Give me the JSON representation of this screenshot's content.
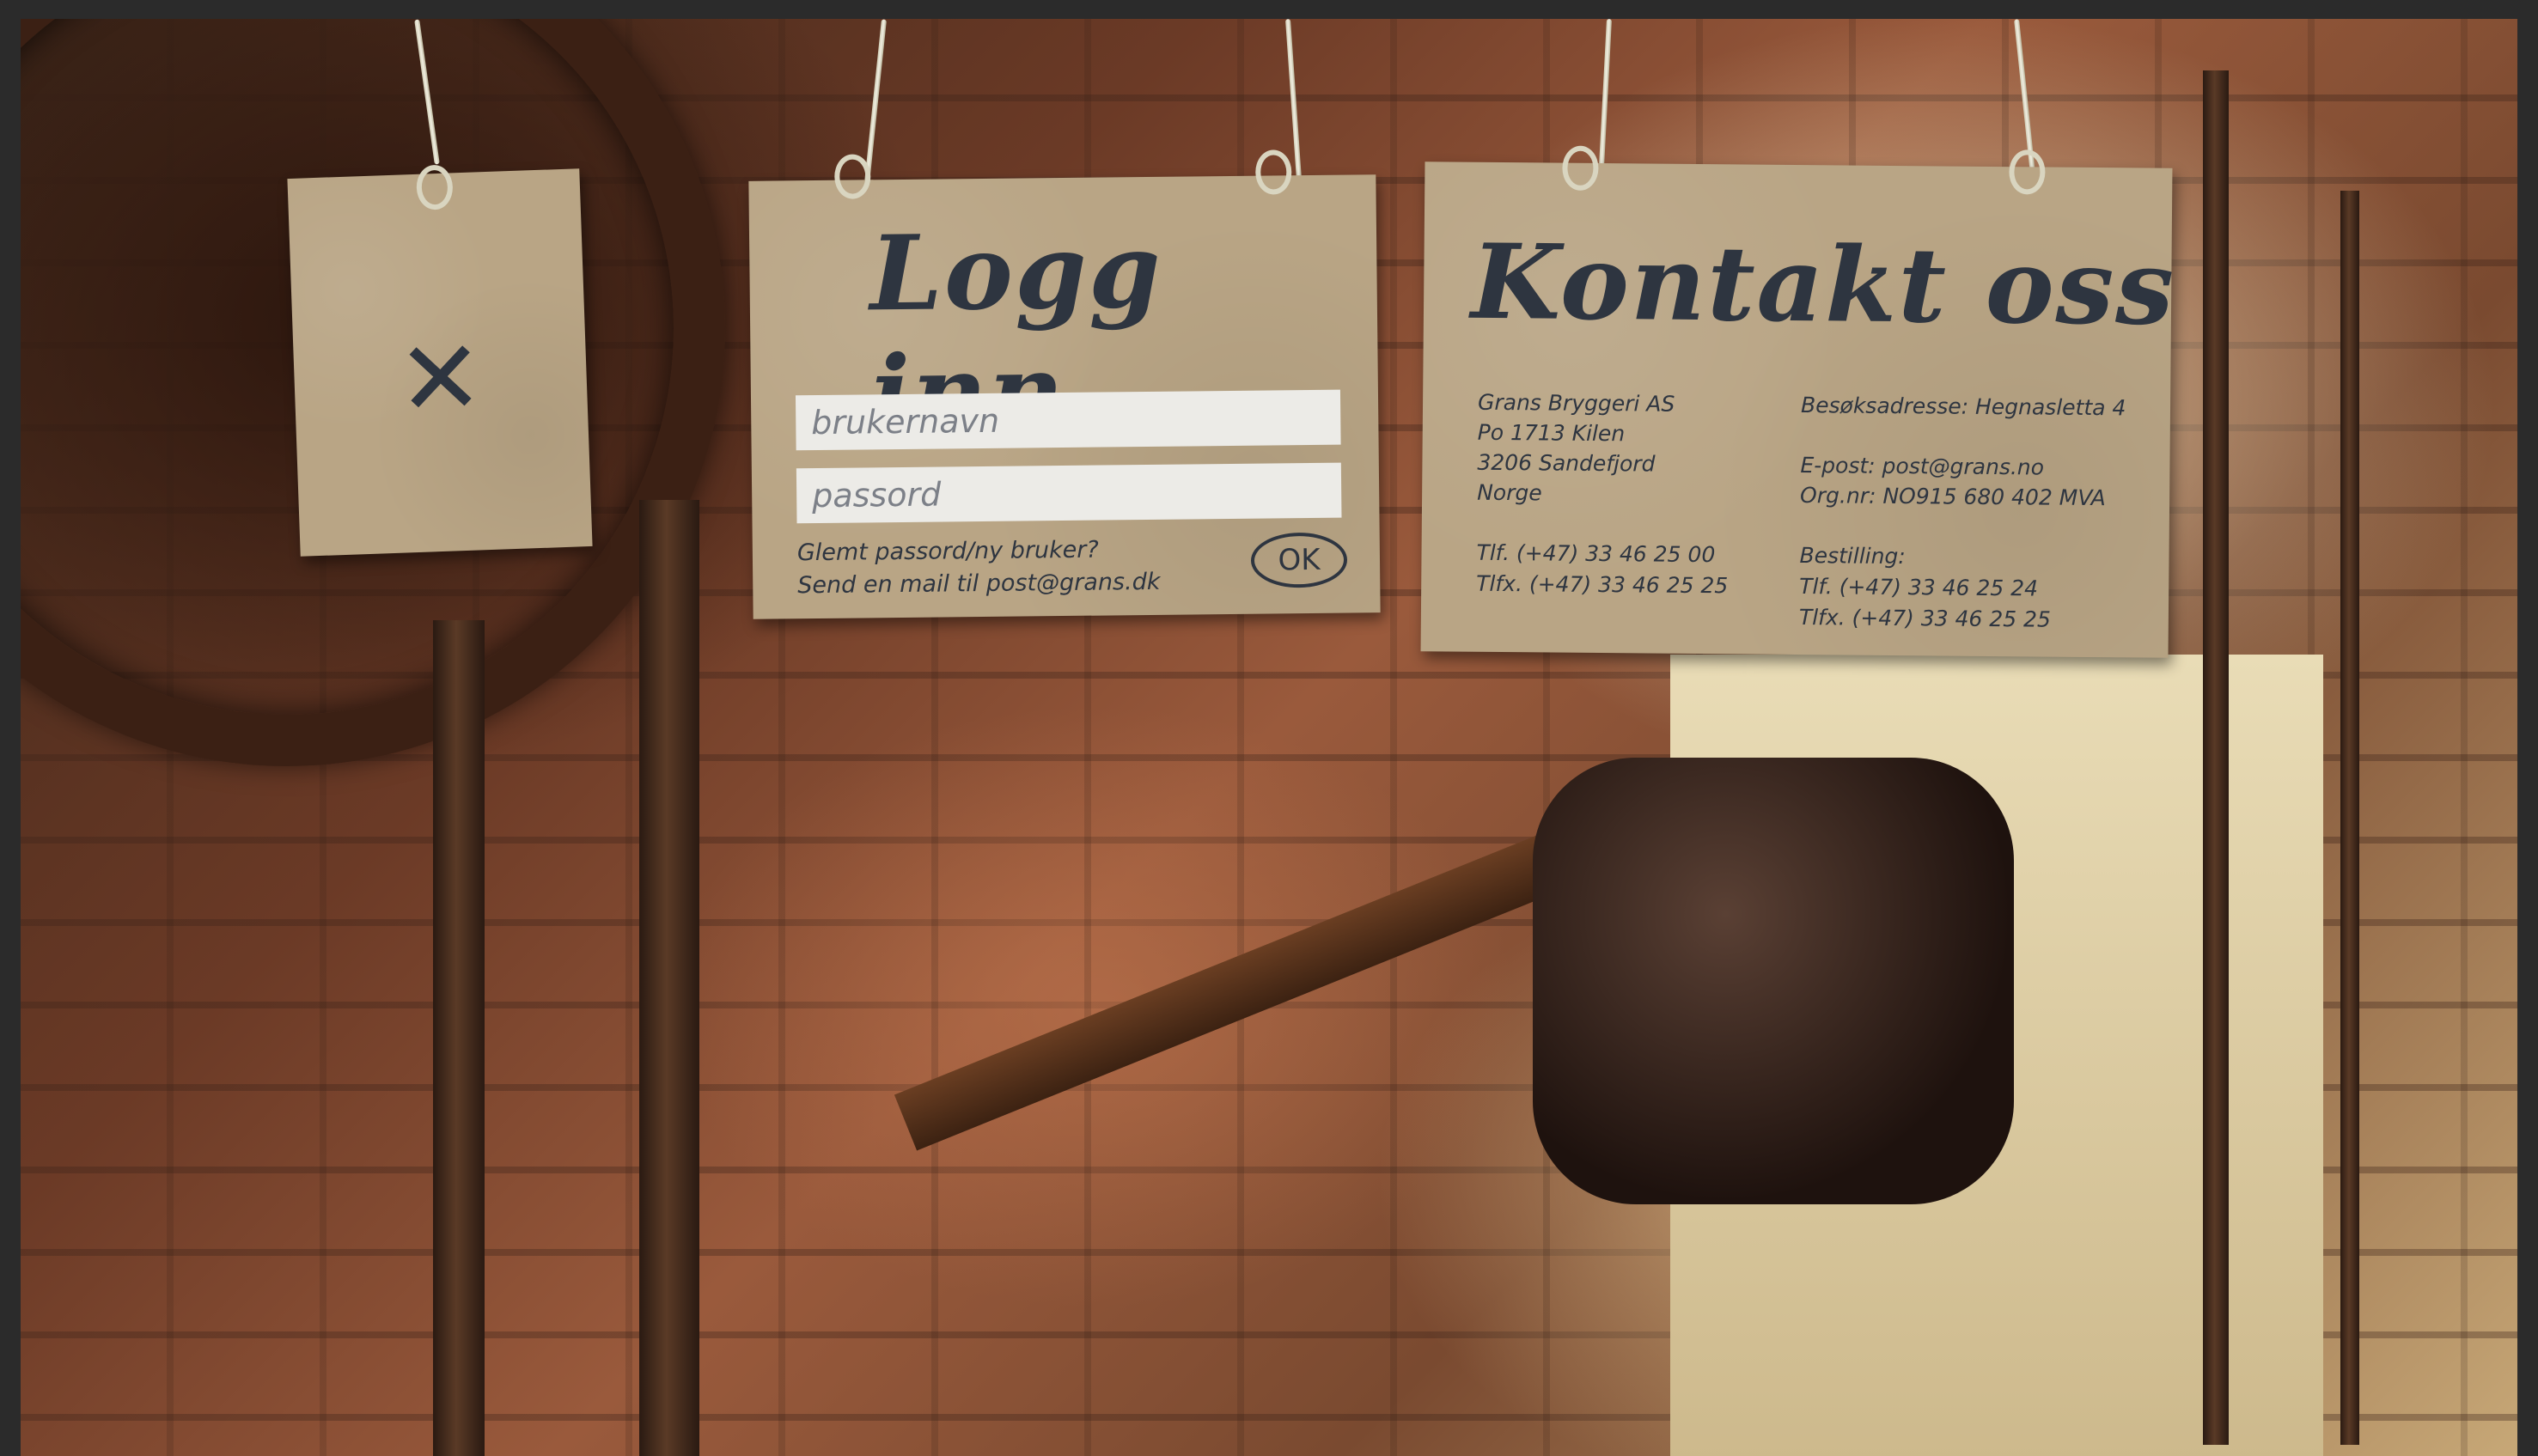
{
  "close_card": {
    "glyph": "✕",
    "icon": "close-icon"
  },
  "login": {
    "title": "Logg inn",
    "username_placeholder": "brukernavn",
    "password_placeholder": "passord",
    "forgot_text": "Glemt passord/ny bruker?",
    "mail_text": "Send en mail til post@grans.dk",
    "ok_label": "OK"
  },
  "contact": {
    "title": "Kontakt oss",
    "left": {
      "company": "Grans Bryggeri AS",
      "po": "Po 1713 Kilen",
      "city": "3206 Sandefjord",
      "country": "Norge",
      "phone": "Tlf. (+47) 33 46 25 00",
      "fax": "Tlfx. (+47) 33 46 25 25"
    },
    "right": {
      "visit": "Besøksadresse: Hegnasletta 4",
      "email": "E-post: post@grans.no",
      "org": "Org.nr: NO915 680 402 MVA",
      "order_label": "Bestilling:",
      "order_phone": "Tlf. (+47) 33 46 25 24",
      "order_fax": "Tlfx. (+47) 33 46 25 25"
    }
  },
  "colors": {
    "card": "#b9a585",
    "ink": "#2e3540",
    "field": "#ecebe7",
    "frame": "#2b2b2b"
  }
}
